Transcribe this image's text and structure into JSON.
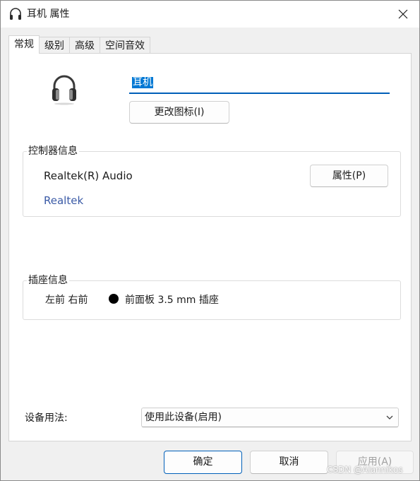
{
  "window": {
    "title": "耳机 属性"
  },
  "tabs": [
    {
      "label": "常规",
      "active": true
    },
    {
      "label": "级别",
      "active": false
    },
    {
      "label": "高级",
      "active": false
    },
    {
      "label": "空间音效",
      "active": false
    }
  ],
  "general": {
    "device_name": "耳机",
    "change_icon_label": "更改图标(I)",
    "controller": {
      "group_label": "控制器信息",
      "name": "Realtek(R) Audio",
      "properties_label": "属性(P)",
      "vendor_link": "Realtek"
    },
    "jack": {
      "group_label": "插座信息",
      "position": "左前 右前",
      "dot_color": "#000000",
      "description": "前面板 3.5 mm 插座"
    },
    "usage": {
      "label": "设备用法:",
      "selected": "使用此设备(启用)"
    }
  },
  "footer": {
    "ok_label": "确定",
    "cancel_label": "取消",
    "apply_label": "应用(A)"
  },
  "watermark": "CSDN @Alannikos",
  "colors": {
    "accent": "#005fb8",
    "selection": "#0078d4",
    "link": "#3a5aa6"
  }
}
